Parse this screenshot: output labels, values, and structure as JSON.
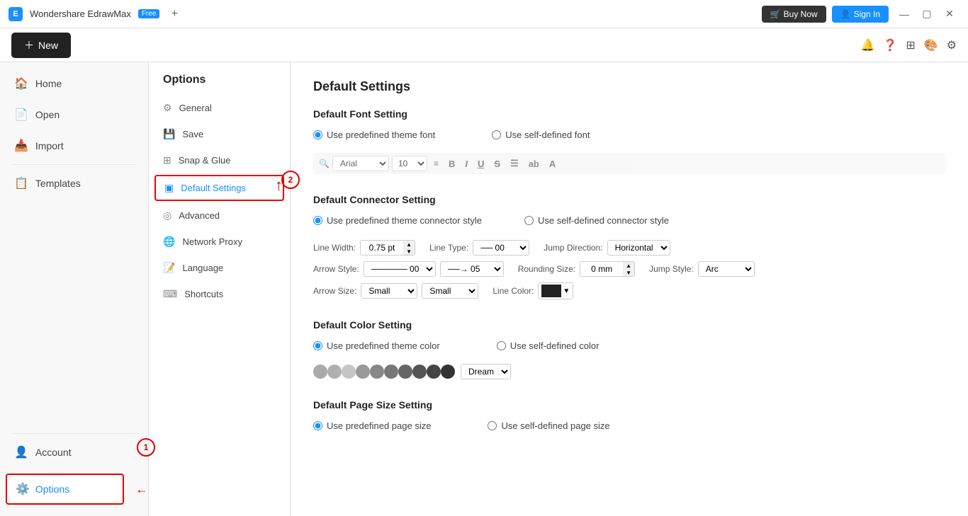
{
  "titlebar": {
    "app_name": "Wondershare EdrawMax",
    "free_badge": "Free",
    "buy_now": "Buy Now",
    "sign_in": "Sign In"
  },
  "toolbar": {
    "new_label": "New"
  },
  "sidebar": {
    "items": [
      {
        "id": "home",
        "label": "Home",
        "icon": "🏠"
      },
      {
        "id": "open",
        "label": "Open",
        "icon": "📄"
      },
      {
        "id": "import",
        "label": "Import",
        "icon": "📥"
      },
      {
        "id": "templates",
        "label": "Templates",
        "icon": "📋"
      }
    ],
    "bottom_items": [
      {
        "id": "account",
        "label": "Account",
        "icon": "👤"
      },
      {
        "id": "options",
        "label": "Options",
        "icon": "⚙️"
      }
    ]
  },
  "options_panel": {
    "title": "Options",
    "items": [
      {
        "id": "general",
        "label": "General",
        "icon": "⚙"
      },
      {
        "id": "save",
        "label": "Save",
        "icon": "💾"
      },
      {
        "id": "snap_glue",
        "label": "Snap & Glue",
        "icon": "⊞"
      },
      {
        "id": "default_settings",
        "label": "Default Settings",
        "icon": "▣",
        "active": true
      },
      {
        "id": "advanced",
        "label": "Advanced",
        "icon": "◎"
      },
      {
        "id": "network_proxy",
        "label": "Network Proxy",
        "icon": "🌐"
      },
      {
        "id": "language",
        "label": "Language",
        "icon": "📝"
      },
      {
        "id": "shortcuts",
        "label": "Shortcuts",
        "icon": "⌨"
      }
    ]
  },
  "content": {
    "title": "Default Settings",
    "font_section": {
      "title": "Default Font Setting",
      "radio1": "Use predefined theme font",
      "radio2": "Use self-defined font",
      "font_value": "Arial",
      "font_size": "10"
    },
    "connector_section": {
      "title": "Default Connector Setting",
      "radio1": "Use predefined theme connector style",
      "radio2": "Use self-defined connector style",
      "line_width_label": "Line Width:",
      "line_width_value": "0.75 pt",
      "line_type_label": "Line Type:",
      "line_type_value": "00",
      "jump_direction_label": "Jump Direction:",
      "jump_direction_value": "Horizontal",
      "arrow_style_label": "Arrow Style:",
      "arrow_style_value1": "00",
      "arrow_style_value2": "05",
      "rounding_size_label": "Rounding Size:",
      "rounding_size_value": "0 mm",
      "jump_style_label": "Jump Style:",
      "jump_style_value": "Arc",
      "arrow_size_label": "Arrow Size:",
      "arrow_size_value1": "Small",
      "arrow_size_value2": "Small",
      "line_color_label": "Line Color:"
    },
    "color_section": {
      "title": "Default Color Setting",
      "radio1": "Use predefined theme color",
      "radio2": "Use self-defined color",
      "scheme_name": "Dream",
      "colors": [
        "#aaa",
        "#bbb",
        "#ccc",
        "#999",
        "#888",
        "#777",
        "#666",
        "#555",
        "#444",
        "#333"
      ]
    },
    "page_size_section": {
      "title": "Default Page Size Setting",
      "radio1": "Use predefined page size",
      "radio2": "Use self-defined page size"
    }
  },
  "annotations": {
    "badge1": "1",
    "badge2": "2"
  }
}
